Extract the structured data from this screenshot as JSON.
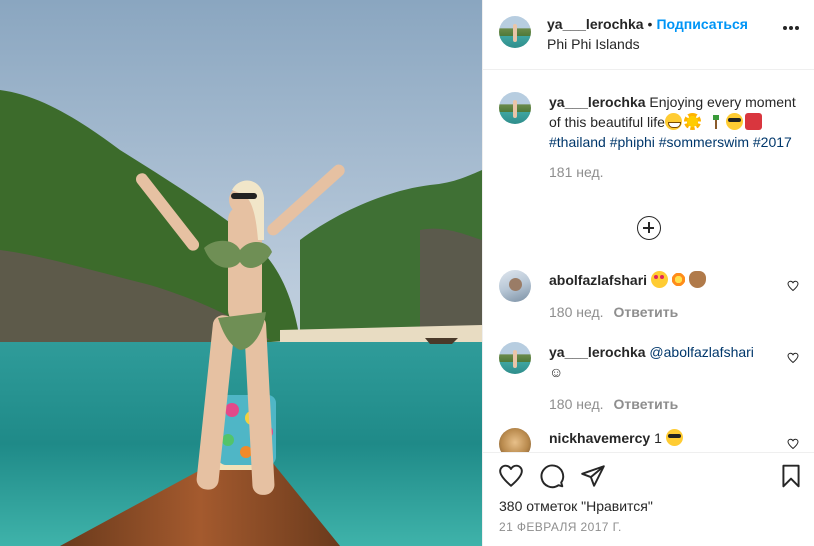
{
  "post": {
    "author": "ya___lerochka",
    "separator": "•",
    "follow_label": "Подписаться",
    "location": "Phi Phi Islands",
    "image_description_icon": "photo"
  },
  "caption": {
    "username": "ya___lerochka",
    "text": "Enjoying every moment of this beautiful life",
    "emojis": [
      "grinning-face",
      "sun",
      "palm-tree",
      "smiling-face-with-sunglasses",
      "bikini"
    ],
    "hashtags": [
      "#thailand",
      "#phiphi",
      "#sommerswim",
      "#2017"
    ],
    "time": "181 нед."
  },
  "comments": [
    {
      "username": "abolfazlafshari",
      "emojis": [
        "smiling-face-with-heart-eyes",
        "collision",
        "clapping-hands"
      ],
      "time": "180 нед.",
      "reply_label": "Ответить"
    },
    {
      "username": "ya___lerochka",
      "mention": "@abolfazlafshari",
      "text": "☺",
      "time": "180 нед.",
      "reply_label": "Ответить"
    },
    {
      "username": "nickhavemercy",
      "text": "1",
      "emojis": [
        "smiling-face-with-sunglasses"
      ]
    }
  ],
  "actions": {
    "likes": "380 отметок \"Нравится\"",
    "date": "21 ФЕВРАЛЯ 2017 Г."
  },
  "icons": {
    "like": "heart-icon",
    "comment": "comment-icon",
    "share": "paper-plane-icon",
    "save": "bookmark-icon",
    "more": "more-options-icon",
    "load_more": "plus-circle-icon"
  },
  "colors": {
    "link_blue": "#0095f6",
    "hashtag": "#00376b",
    "muted": "#8e8e8e",
    "text": "#262626"
  }
}
